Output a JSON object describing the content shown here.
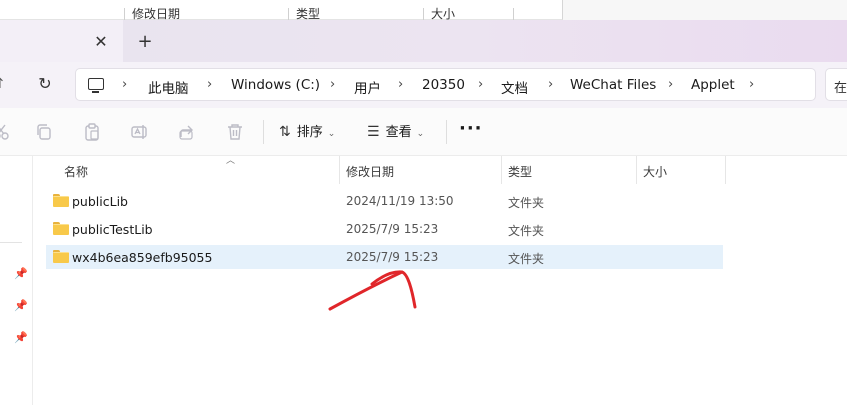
{
  "background_window": {
    "columns": [
      "修改日期",
      "类型",
      "大小"
    ]
  },
  "tab": {
    "close_glyph": "✕",
    "add_glyph": "+"
  },
  "navigation": {
    "up_glyph": "↑",
    "refresh_glyph": "↻"
  },
  "breadcrumbs": [
    {
      "label": "此电脑"
    },
    {
      "label": "Windows (C:)"
    },
    {
      "label": "用户"
    },
    {
      "label": "20350"
    },
    {
      "label": "文档"
    },
    {
      "label": "WeChat Files"
    },
    {
      "label": "Applet"
    }
  ],
  "search": {
    "placeholder": "在"
  },
  "toolbar": {
    "sort_label": "排序",
    "view_label": "查看",
    "more_label": "···",
    "icons": [
      "cut-icon",
      "copy-icon",
      "paste-icon",
      "rename-icon",
      "share-icon",
      "delete-icon"
    ]
  },
  "columns": {
    "name": "名称",
    "modified": "修改日期",
    "type": "类型",
    "size": "大小"
  },
  "files": [
    {
      "name": "publicLib",
      "modified": "2024/11/19 13:50",
      "type": "文件夹",
      "selected": false
    },
    {
      "name": "publicTestLib",
      "modified": "2025/7/9 15:23",
      "type": "文件夹",
      "selected": false
    },
    {
      "name": "wx4b6ea859efb95055",
      "modified": "2025/7/9 15:23",
      "type": "文件夹",
      "selected": true
    }
  ],
  "colors": {
    "selection": "#e5f1fb",
    "folder": "#f8c94a",
    "annotation": "#e0262a"
  }
}
